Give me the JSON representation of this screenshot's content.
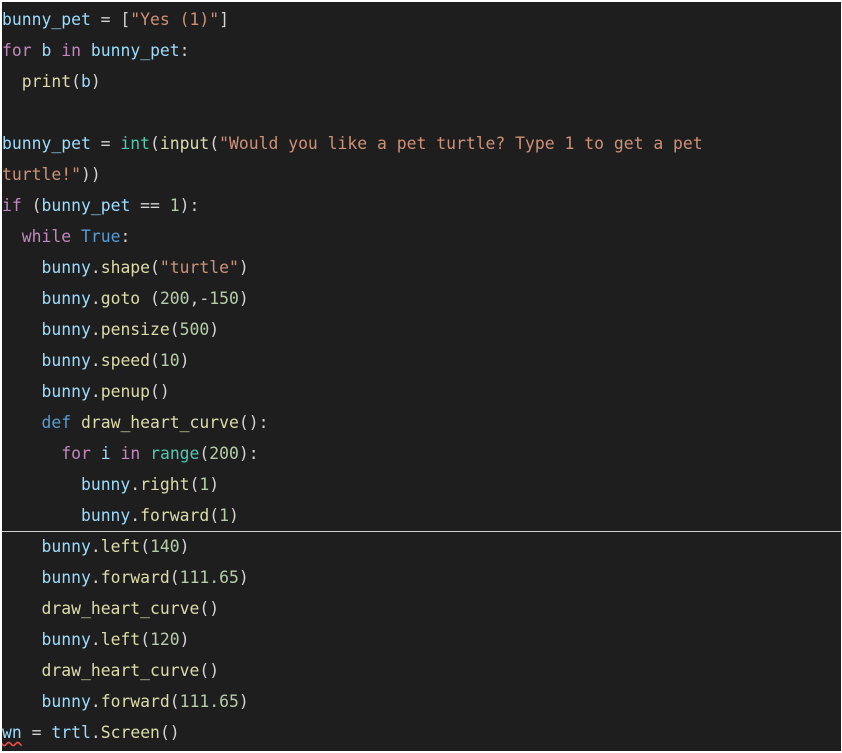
{
  "colors": {
    "background": "#1e1e1e",
    "variable": "#9cdcfe",
    "keyword_control": "#c586c0",
    "keyword": "#569cd6",
    "builtin_type": "#4ec9b0",
    "function": "#dcdcaa",
    "string": "#ce9178",
    "number": "#b5cea8",
    "punctuation": "#d4d4d4",
    "error_underline": "#f14c4c"
  },
  "code_lines": [
    [
      [
        "bunny_pet",
        "variable"
      ],
      [
        " = [",
        "punctuation"
      ],
      [
        "\"Yes (1)\"",
        "string"
      ],
      [
        "]",
        "punctuation"
      ]
    ],
    [
      [
        "for",
        "keyword_control"
      ],
      [
        " ",
        "punctuation"
      ],
      [
        "b",
        "variable"
      ],
      [
        " ",
        "punctuation"
      ],
      [
        "in",
        "keyword_control"
      ],
      [
        " ",
        "punctuation"
      ],
      [
        "bunny_pet",
        "variable"
      ],
      [
        ":",
        "punctuation"
      ]
    ],
    [
      [
        "  ",
        "punctuation"
      ],
      [
        "print",
        "function"
      ],
      [
        "(",
        "punctuation"
      ],
      [
        "b",
        "variable"
      ],
      [
        ")",
        "punctuation"
      ]
    ],
    [],
    [
      [
        "bunny_pet",
        "variable"
      ],
      [
        " = ",
        "punctuation"
      ],
      [
        "int",
        "builtin_type"
      ],
      [
        "(",
        "punctuation"
      ],
      [
        "input",
        "function"
      ],
      [
        "(",
        "punctuation"
      ],
      [
        "\"Would you like a pet turtle? Type 1 to get a pet",
        "string"
      ]
    ],
    [
      [
        "turtle!\"",
        "string"
      ],
      [
        "))",
        "punctuation"
      ]
    ],
    [
      [
        "if",
        "keyword_control"
      ],
      [
        " (",
        "punctuation"
      ],
      [
        "bunny_pet",
        "variable"
      ],
      [
        " == ",
        "punctuation"
      ],
      [
        "1",
        "number"
      ],
      [
        "):",
        "punctuation"
      ]
    ],
    [
      [
        "  ",
        "punctuation"
      ],
      [
        "while",
        "keyword_control"
      ],
      [
        " ",
        "punctuation"
      ],
      [
        "True",
        "keyword"
      ],
      [
        ":",
        "punctuation"
      ]
    ],
    [
      [
        "    ",
        "punctuation"
      ],
      [
        "bunny",
        "variable"
      ],
      [
        ".",
        "punctuation"
      ],
      [
        "shape",
        "function"
      ],
      [
        "(",
        "punctuation"
      ],
      [
        "\"turtle\"",
        "string"
      ],
      [
        ")",
        "punctuation"
      ]
    ],
    [
      [
        "    ",
        "punctuation"
      ],
      [
        "bunny",
        "variable"
      ],
      [
        ".",
        "punctuation"
      ],
      [
        "goto",
        "function"
      ],
      [
        " (",
        "punctuation"
      ],
      [
        "200",
        "number"
      ],
      [
        ",-",
        "punctuation"
      ],
      [
        "150",
        "number"
      ],
      [
        ")",
        "punctuation"
      ]
    ],
    [
      [
        "    ",
        "punctuation"
      ],
      [
        "bunny",
        "variable"
      ],
      [
        ".",
        "punctuation"
      ],
      [
        "pensize",
        "function"
      ],
      [
        "(",
        "punctuation"
      ],
      [
        "500",
        "number"
      ],
      [
        ")",
        "punctuation"
      ]
    ],
    [
      [
        "    ",
        "punctuation"
      ],
      [
        "bunny",
        "variable"
      ],
      [
        ".",
        "punctuation"
      ],
      [
        "speed",
        "function"
      ],
      [
        "(",
        "punctuation"
      ],
      [
        "10",
        "number"
      ],
      [
        ")",
        "punctuation"
      ]
    ],
    [
      [
        "    ",
        "punctuation"
      ],
      [
        "bunny",
        "variable"
      ],
      [
        ".",
        "punctuation"
      ],
      [
        "penup",
        "function"
      ],
      [
        "()",
        "punctuation"
      ]
    ],
    [
      [
        "    ",
        "punctuation"
      ],
      [
        "def",
        "keyword"
      ],
      [
        " ",
        "punctuation"
      ],
      [
        "draw_heart_curve",
        "function"
      ],
      [
        "():",
        "punctuation"
      ]
    ],
    [
      [
        "      ",
        "punctuation"
      ],
      [
        "for",
        "keyword_control"
      ],
      [
        " ",
        "punctuation"
      ],
      [
        "i",
        "variable"
      ],
      [
        " ",
        "punctuation"
      ],
      [
        "in",
        "keyword_control"
      ],
      [
        " ",
        "punctuation"
      ],
      [
        "range",
        "builtin_type"
      ],
      [
        "(",
        "punctuation"
      ],
      [
        "200",
        "number"
      ],
      [
        "):",
        "punctuation"
      ]
    ],
    [
      [
        "        ",
        "punctuation"
      ],
      [
        "bunny",
        "variable"
      ],
      [
        ".",
        "punctuation"
      ],
      [
        "right",
        "function"
      ],
      [
        "(",
        "punctuation"
      ],
      [
        "1",
        "number"
      ],
      [
        ")",
        "punctuation"
      ]
    ],
    [
      [
        "        ",
        "punctuation"
      ],
      [
        "bunny",
        "variable"
      ],
      [
        ".",
        "punctuation"
      ],
      [
        "forward",
        "function"
      ],
      [
        "(",
        "punctuation"
      ],
      [
        "1",
        "number"
      ],
      [
        ")",
        "punctuation"
      ]
    ],
    [
      [
        "    ",
        "punctuation"
      ],
      [
        "bunny",
        "variable"
      ],
      [
        ".",
        "punctuation"
      ],
      [
        "left",
        "function"
      ],
      [
        "(",
        "punctuation"
      ],
      [
        "140",
        "number"
      ],
      [
        ")",
        "punctuation"
      ]
    ],
    [
      [
        "    ",
        "punctuation"
      ],
      [
        "bunny",
        "variable"
      ],
      [
        ".",
        "punctuation"
      ],
      [
        "forward",
        "function"
      ],
      [
        "(",
        "punctuation"
      ],
      [
        "111.65",
        "number"
      ],
      [
        ")",
        "punctuation"
      ]
    ],
    [
      [
        "    ",
        "punctuation"
      ],
      [
        "draw_heart_curve",
        "function"
      ],
      [
        "()",
        "punctuation"
      ]
    ],
    [
      [
        "    ",
        "punctuation"
      ],
      [
        "bunny",
        "variable"
      ],
      [
        ".",
        "punctuation"
      ],
      [
        "left",
        "function"
      ],
      [
        "(",
        "punctuation"
      ],
      [
        "120",
        "number"
      ],
      [
        ")",
        "punctuation"
      ]
    ],
    [
      [
        "    ",
        "punctuation"
      ],
      [
        "draw_heart_curve",
        "function"
      ],
      [
        "()",
        "punctuation"
      ]
    ],
    [
      [
        "    ",
        "punctuation"
      ],
      [
        "bunny",
        "variable"
      ],
      [
        ".",
        "punctuation"
      ],
      [
        "forward",
        "function"
      ],
      [
        "(",
        "punctuation"
      ],
      [
        "111.65",
        "number"
      ],
      [
        ")",
        "punctuation"
      ]
    ],
    [
      [
        "wn",
        "variable_error"
      ],
      [
        " = ",
        "punctuation"
      ],
      [
        "trtl",
        "variable"
      ],
      [
        ".",
        "punctuation"
      ],
      [
        "Screen",
        "function"
      ],
      [
        "()",
        "punctuation"
      ]
    ]
  ]
}
